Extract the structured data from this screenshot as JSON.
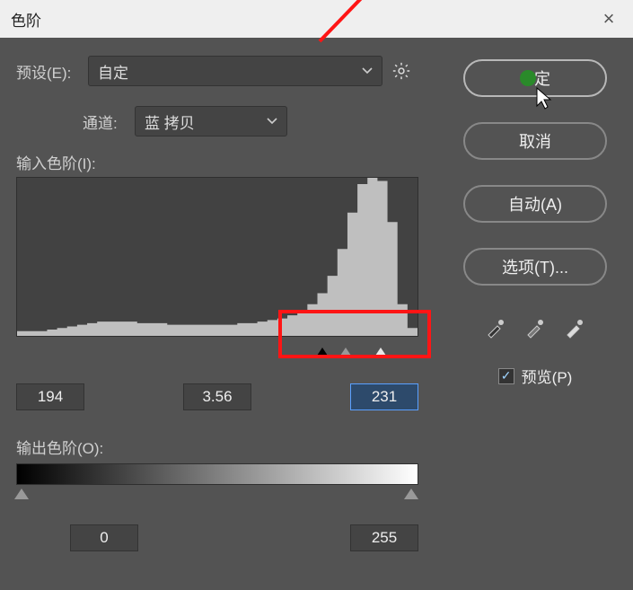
{
  "dialog": {
    "title": "色阶",
    "preset_label": "预设(E):",
    "preset_value": "自定",
    "channel_label": "通道:",
    "channel_value": "蓝 拷贝",
    "input_levels_label": "输入色阶(I):",
    "output_levels_label": "输出色阶(O):",
    "input_black": "194",
    "input_gamma": "3.56",
    "input_white": "231",
    "output_black": "0",
    "output_white": "255"
  },
  "buttons": {
    "ok": "定",
    "cancel": "取消",
    "auto": "自动(A)",
    "options": "选项(T)..."
  },
  "preview": {
    "label": "预览(P)",
    "checked": true
  },
  "chart_data": {
    "type": "area",
    "title": "",
    "xlabel": "",
    "ylabel": "",
    "x_range": [
      0,
      255
    ],
    "values_approx_percent": [
      3,
      3,
      3,
      4,
      5,
      6,
      7,
      8,
      9,
      9,
      9,
      9,
      8,
      8,
      8,
      7,
      7,
      7,
      7,
      7,
      7,
      7,
      8,
      8,
      9,
      10,
      11,
      13,
      16,
      20,
      27,
      38,
      55,
      78,
      96,
      100,
      98,
      72,
      20,
      5
    ],
    "note": "40 buckets across 0..255; value = percent of max bar height"
  }
}
